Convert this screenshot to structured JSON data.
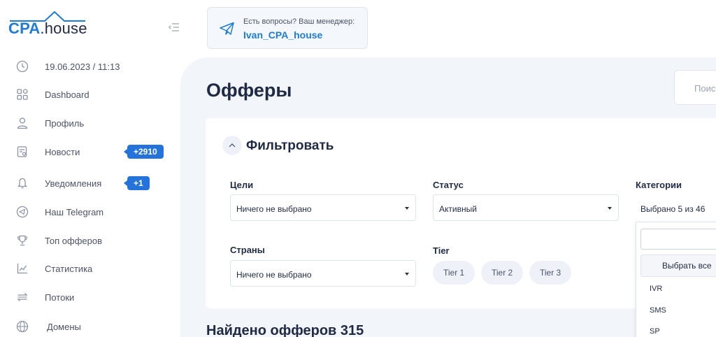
{
  "brand": {
    "logo_main": "CPA",
    "logo_sep": ".",
    "logo_tail": "house"
  },
  "sidebar": {
    "items": [
      {
        "label": "19.06.2023 / 11:13",
        "icon": "clock-icon"
      },
      {
        "label": "Dashboard",
        "icon": "dashboard-icon"
      },
      {
        "label": "Профиль",
        "icon": "user-icon"
      },
      {
        "label": "Новости",
        "icon": "news-icon",
        "badge": "+2910"
      },
      {
        "label": "Уведомления",
        "icon": "bell-icon",
        "badge": "+1"
      },
      {
        "label": "Наш Telegram",
        "icon": "telegram-icon"
      },
      {
        "label": "Топ офферов",
        "icon": "trophy-icon"
      },
      {
        "label": "Статистика",
        "icon": "chart-icon"
      },
      {
        "label": "Потоки",
        "icon": "flows-icon"
      },
      {
        "label": "Домены",
        "icon": "globe-icon"
      }
    ]
  },
  "manager": {
    "question": "Есть вопросы? Ваш менеджер:",
    "name": "Ivan_CPA_house"
  },
  "main": {
    "title": "Офферы",
    "search_placeholder": "Поис",
    "filter_title": "Фильтровать",
    "fields": {
      "goals": {
        "label": "Цели",
        "value": "Ничего не выбрано"
      },
      "status": {
        "label": "Статус",
        "value": "Активный"
      },
      "categories": {
        "label": "Категории",
        "value": "Выбрано 5 из 46"
      },
      "countries": {
        "label": "Страны",
        "value": "Ничего не выбрано"
      },
      "tier": {
        "label": "Tier",
        "options": [
          "Tier 1",
          "Tier 2",
          "Tier 3"
        ]
      }
    },
    "categories_dropdown": {
      "select_all": "Выбрать все",
      "options": [
        "IVR",
        "SMS",
        "SP"
      ]
    },
    "found": "Найдено офферов 315"
  },
  "colors": {
    "accent": "#2473db",
    "brand_blue": "#1f7bd8",
    "main_bg": "#f2f5fa"
  }
}
